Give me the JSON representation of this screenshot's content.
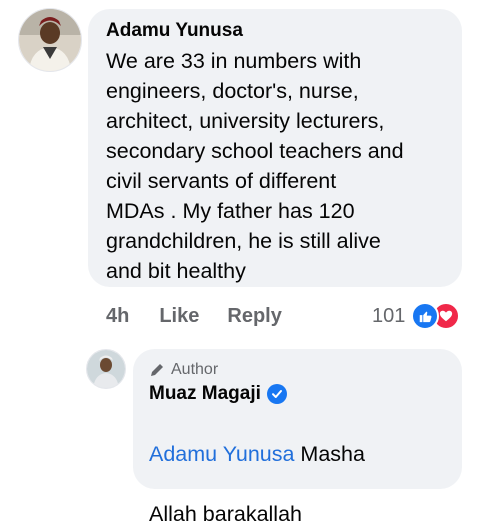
{
  "comment": {
    "author": "Adamu Yunusa",
    "text": "We are 33 in numbers with\nengineers,  doctor's, nurse,\narchitect, university lecturers,\nsecondary school teachers and\ncivil servants of different\nMDAs . My father has   120\ngrandchildren, he is still alive\nand bit healthy",
    "time": "4h",
    "like_label": "Like",
    "reply_label": "Reply",
    "reaction_count": "101",
    "reactions": [
      "like-react-icon",
      "love-react-icon"
    ]
  },
  "reply": {
    "badge_label": "Author",
    "author": "Muaz Magaji",
    "verified": true,
    "mention": "Adamu Yunusa",
    "text_line1_after_mention": " Masha",
    "text_line2": "Allah barakallah"
  },
  "colors": {
    "bubble": "#f0f2f5",
    "link": "#216fdb",
    "meta": "#65676b",
    "like_blue": "#1877f2",
    "love_red": "#f02849"
  }
}
